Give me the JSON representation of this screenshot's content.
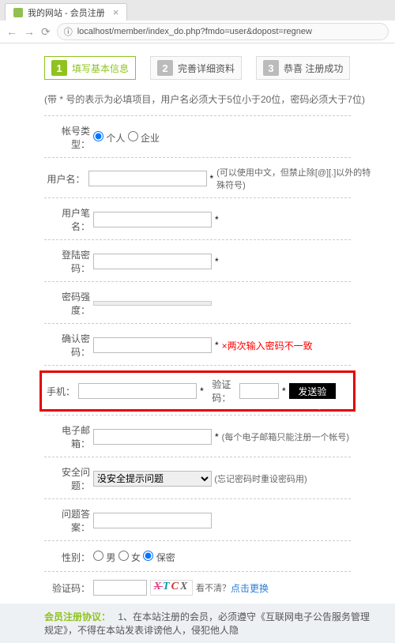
{
  "browser": {
    "tab_title": "我的网站 - 会员注册",
    "url": "localhost/member/index_do.php?fmdo=user&dopost=regnew"
  },
  "steps": [
    {
      "num": "1",
      "label": "填写基本信息"
    },
    {
      "num": "2",
      "label": "完善详细资料"
    },
    {
      "num": "3",
      "label": "恭喜 注册成功"
    }
  ],
  "note": "(带 * 号的表示为必填项目，用户名必须大于5位小于20位，密码必须大于7位)",
  "account_type": {
    "label": "帐号类型：",
    "opt_personal": "个人",
    "opt_company": "企业"
  },
  "fields": {
    "username": {
      "label": "用户名：",
      "hint": "(可以使用中文，但禁止除[@][.]以外的特殊符号)"
    },
    "nickname": {
      "label": "用户笔名："
    },
    "password": {
      "label": "登陆密码："
    },
    "strength": {
      "label": "密码强度："
    },
    "confirm": {
      "label": "确认密码：",
      "err": "×两次输入密码不一致"
    },
    "phone": {
      "label": "手机：",
      "code_label": "验证码：",
      "send_btn": "发送验证码"
    },
    "email": {
      "label": "电子邮箱：",
      "hint": "(每个电子邮箱只能注册一个帐号)"
    },
    "question": {
      "label": "安全问题：",
      "option": "没安全提示问题",
      "hint": "(忘记密码时重设密码用)"
    },
    "answer": {
      "label": "问题答案："
    },
    "gender": {
      "label": "性别：",
      "m": "男",
      "f": "女",
      "s": "保密"
    },
    "captcha": {
      "label": "验证码：",
      "cant": "看不清？",
      "refresh": "点击更换"
    }
  },
  "footer": {
    "title": "会员注册协议：",
    "text": "1、在本站注册的会员，必须遵守《互联网电子公告服务管理规定》，不得在本站发表诽谤他人，侵犯他人隐"
  }
}
